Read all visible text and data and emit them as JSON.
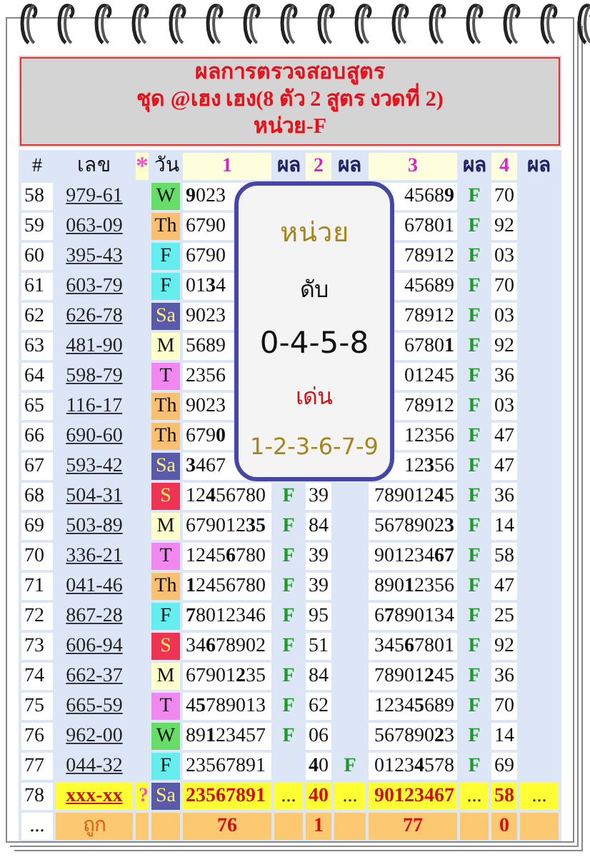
{
  "title": {
    "lines": [
      "ผลการตรวจสอบสูตร",
      "ชุด @เฮง เฮง(8 ตัว 2 สูตร งวดที่ 2)",
      "หน่วย-F"
    ]
  },
  "headers": [
    {
      "label": "#",
      "kind": "plain"
    },
    {
      "label": "เลข",
      "kind": "plain"
    },
    {
      "label": "*",
      "kind": "mark"
    },
    {
      "label": "วัน",
      "kind": "plain"
    },
    {
      "label": "1",
      "kind": "number"
    },
    {
      "label": "ผล",
      "kind": "result"
    },
    {
      "label": "2",
      "kind": "number"
    },
    {
      "label": "ผล",
      "kind": "result"
    },
    {
      "label": "3",
      "kind": "number"
    },
    {
      "label": "ผล",
      "kind": "result"
    },
    {
      "label": "4",
      "kind": "number"
    },
    {
      "label": "ผล",
      "kind": "result"
    }
  ],
  "rows": [
    {
      "kind": "checked",
      "num": "58",
      "code": "979-61",
      "day": {
        "label": "W",
        "color": "#66dd66"
      },
      "c1": "**9**023",
      "c3": "4568**9**",
      "r3": "F",
      "c4": "70"
    },
    {
      "kind": "checked",
      "num": "59",
      "code": "063-09",
      "day": {
        "label": "Th",
        "color": "#f8c070"
      },
      "c1": "6790",
      "c3": "67801",
      "r3": "F",
      "c4": "92"
    },
    {
      "kind": "checked",
      "num": "60",
      "code": "395-43",
      "day": {
        "label": "F",
        "color": "#66eeee"
      },
      "c1": "6790",
      "c3": "78912",
      "r3": "F",
      "c4": "03"
    },
    {
      "kind": "checked",
      "num": "61",
      "code": "603-79",
      "day": {
        "label": "F",
        "color": "#66eeee"
      },
      "c1": "01**3**4",
      "c3": "45689",
      "r3": "F",
      "c4": "70"
    },
    {
      "kind": "checked",
      "num": "62",
      "code": "626-78",
      "day": {
        "label": "Sa",
        "color": "#5a5aaa"
      },
      "c1": "9023",
      "c3": "78912",
      "r3": "F",
      "c4": "03"
    },
    {
      "kind": "checked",
      "num": "63",
      "code": "481-90",
      "day": {
        "label": "M",
        "color": "#ffffcc"
      },
      "c1": "5689",
      "c3": "6780**1**",
      "r3": "F",
      "c4": "92"
    },
    {
      "kind": "checked",
      "num": "64",
      "code": "598-79",
      "day": {
        "label": "T",
        "color": "#f088f0"
      },
      "c1": "2356",
      "c3": "01245",
      "r3": "F",
      "c4": "36"
    },
    {
      "kind": "checked",
      "num": "65",
      "code": "116-17",
      "day": {
        "label": "Th",
        "color": "#f8c070"
      },
      "c1": "9023",
      "c3": "78912",
      "r3": "F",
      "c4": "03"
    },
    {
      "kind": "checked",
      "num": "66",
      "code": "690-60",
      "day": {
        "label": "Th",
        "color": "#f8c070"
      },
      "c1": "679**0**",
      "c3": "12356",
      "r3": "F",
      "c4": "47"
    },
    {
      "kind": "checked",
      "num": "67",
      "code": "593-42",
      "day": {
        "label": "Sa",
        "color": "#5a5aaa"
      },
      "c1": "**3**467",
      "c3": "12**3**56",
      "r3": "F",
      "c4": "47"
    },
    {
      "kind": "checked",
      "num": "68",
      "code": "504-31",
      "day": {
        "label": "S",
        "color": "#ee3355"
      },
      "c1": "12**4**56780",
      "r1": "F",
      "c2": "39",
      "c3": "789012**4**5",
      "r3": "F",
      "c4": "36"
    },
    {
      "kind": "checked",
      "num": "69",
      "code": "503-89",
      "day": {
        "label": "M",
        "color": "#ffffcc"
      },
      "c1": "679012**35**",
      "r1": "F",
      "c2": "84",
      "c3": "5678902**3**",
      "r3": "F",
      "c4": "14"
    },
    {
      "kind": "checked",
      "num": "70",
      "code": "336-21",
      "day": {
        "label": "T",
        "color": "#f088f0"
      },
      "c1": "1245**6**780",
      "r1": "F",
      "c2": "39",
      "c3": "901234**67**",
      "r3": "F",
      "c4": "58"
    },
    {
      "kind": "checked",
      "num": "71",
      "code": "041-46",
      "day": {
        "label": "Th",
        "color": "#f8c070"
      },
      "c1": "**1**2456780",
      "r1": "F",
      "c2": "39",
      "c3": "890**1**2356",
      "r3": "F",
      "c4": "47"
    },
    {
      "kind": "checked",
      "num": "72",
      "code": "867-28",
      "day": {
        "label": "F",
        "color": "#66eeee"
      },
      "c1": "**7**8012346",
      "r1": "F",
      "c2": "95",
      "c3": "6**7**890134",
      "r3": "F",
      "c4": "25"
    },
    {
      "kind": "checked",
      "num": "73",
      "code": "606-94",
      "day": {
        "label": "S",
        "color": "#ee3355"
      },
      "c1": "34**6**78902",
      "r1": "F",
      "c2": "51",
      "c3": "345**6**7801",
      "r3": "F",
      "c4": "92"
    },
    {
      "kind": "checked",
      "num": "74",
      "code": "662-37",
      "day": {
        "label": "M",
        "color": "#ffffcc"
      },
      "c1": "67901**2**35",
      "r1": "F",
      "c2": "84",
      "c3": "78901**2**45",
      "r3": "F",
      "c4": "36"
    },
    {
      "kind": "checked",
      "num": "75",
      "code": "665-59",
      "day": {
        "label": "T",
        "color": "#f088f0"
      },
      "c1": "4**5**789013",
      "r1": "F",
      "c2": "62",
      "c3": "1234**5**689",
      "r3": "F",
      "c4": "70"
    },
    {
      "kind": "checked",
      "num": "76",
      "code": "962-00",
      "day": {
        "label": "W",
        "color": "#66dd66"
      },
      "c1": "89**1**23457",
      "r1": "F",
      "c2": "06",
      "c3": "567890**2**3",
      "r3": "F",
      "c4": "14"
    },
    {
      "kind": "checked",
      "num": "77",
      "code": "044-32",
      "day": {
        "label": "F",
        "color": "#66eeee"
      },
      "c1": "23567891",
      "c2": "**4**0",
      "r2": "F",
      "c3": "0123**4**578",
      "r3": "F",
      "c4": "69"
    },
    {
      "kind": "pending",
      "num": "78",
      "code": "xxx-xx",
      "mark": "?",
      "day": {
        "label": "Sa",
        "color": "#5a5aaa"
      },
      "c1": "23567891",
      "r1": "...",
      "c2": "40",
      "r2": "...",
      "c3": "90123467",
      "r3": "...",
      "c4": "58",
      "r4": "..."
    }
  ],
  "footer": {
    "more": "...",
    "label": "ถูก",
    "hits": [
      "76",
      "1",
      "77",
      "0"
    ]
  },
  "popup": {
    "title": "หน่วย",
    "off_label": "ดับ",
    "off": "0-4-5-8",
    "top_label": "เด่น",
    "top": "1-2-3-6-7-9"
  }
}
